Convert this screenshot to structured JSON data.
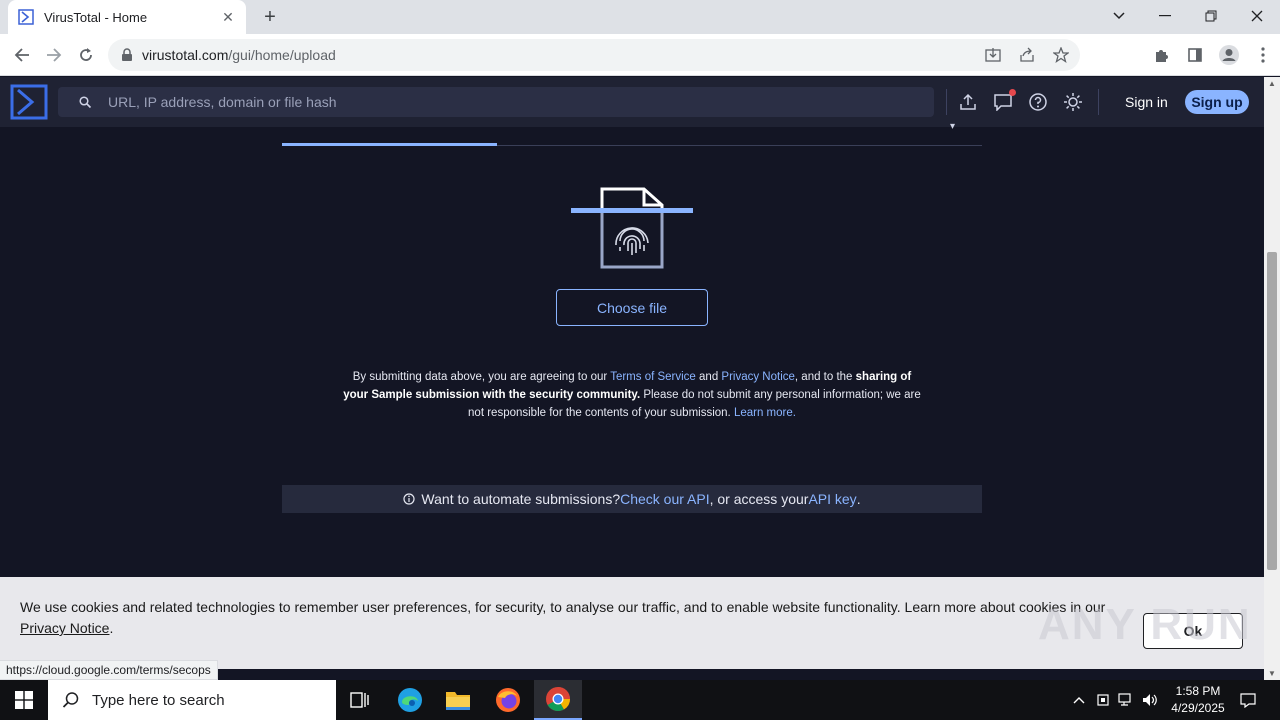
{
  "browser": {
    "tab_title": "VirusTotal - Home",
    "url_host": "virustotal.com",
    "url_path": "/gui/home/upload"
  },
  "vt_header": {
    "search_placeholder": "URL, IP address, domain or file hash",
    "signin_label": "Sign in",
    "signup_label": "Sign up"
  },
  "upload": {
    "choose_file_label": "Choose file",
    "legal": {
      "part1": "By submitting data above, you are agreeing to our ",
      "terms_link": "Terms of Service",
      "part2": " and ",
      "privacy_link": "Privacy Notice",
      "part3": ", and to the ",
      "bold_text": "sharing of your Sample submission with the security community.",
      "part4": " Please do not submit any personal information; we are not responsible for the contents of your submission. ",
      "learn_more": "Learn more."
    },
    "api_bar": {
      "part1": "Want to automate submissions? ",
      "api_link": "Check our API",
      "part2": ", or access your ",
      "key_link": "API key",
      "part3": "."
    }
  },
  "cookie_banner": {
    "text": "We use cookies and related technologies to remember user preferences, for security, to analyse our traffic, and to enable website functionality. Learn more about cookies in our ",
    "link": "Privacy Notice",
    "tail": ".",
    "ok_label": "Ok"
  },
  "status_bar_url": "https://cloud.google.com/terms/secops",
  "watermark": "ANY RUN",
  "taskbar": {
    "search_placeholder": "Type here to search",
    "time": "1:58 PM",
    "date": "4/29/2025"
  },
  "colors": {
    "accent": "#8ab4ff",
    "page_bg": "#131524",
    "header_bg": "#1f2233"
  }
}
